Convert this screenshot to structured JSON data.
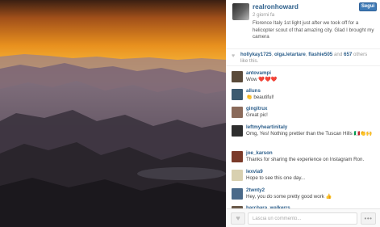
{
  "post": {
    "username": "realronhoward",
    "follow_label": "Segui",
    "time_ago": "2 giorni fa",
    "caption": "Florence Italy 1st light just after we took off for a helicopter scout of that amazing city. Glad I brought my camera"
  },
  "likes": {
    "user1": "hollykay1725",
    "sep1": ", ",
    "user2": "olga.letartare",
    "sep2": ", ",
    "user3": "flashie505",
    "and_text": " and ",
    "count": "657",
    "others_text": " others like this."
  },
  "comments": [
    {
      "user": "antovampi",
      "text": "Wow ❤️❤️❤️",
      "avatar_color": "#5a4a3a"
    },
    {
      "user": "alluns",
      "text": "👏 beautiful!",
      "avatar_color": "#3c5a70"
    },
    {
      "user": "gingitrux",
      "text": "Great pic!",
      "avatar_color": "#8a6a5a"
    },
    {
      "user": "leftmyheartinitaly",
      "text": "Omg, Yes! Nothing prettier than the Tuscan Hills 🇮🇹👏🙌",
      "avatar_color": "#2e2e2e"
    },
    {
      "user": "joe_karson",
      "text": "Thanks for sharing the experience on Instagram Ron.",
      "avatar_color": "#7a3a2a"
    },
    {
      "user": "lexvia9",
      "text": "Hope to see this one day...",
      "avatar_color": "#d8d0b0"
    },
    {
      "user": "2twnty2",
      "text": "Hey, you do some pretty good work 👍",
      "avatar_color": "#4a6a8a"
    },
    {
      "user": "barcbara_walkerrs",
      "text": "",
      "avatar_color": "#6a5a4a"
    }
  ],
  "footer": {
    "comment_placeholder": "Lascia un commento...",
    "more_label": "•••"
  },
  "colors": {
    "link": "#2d5f8b",
    "follow_button": "#3f7ab5"
  },
  "icons": {
    "like": "heart-icon",
    "more": "ellipsis-icon"
  }
}
